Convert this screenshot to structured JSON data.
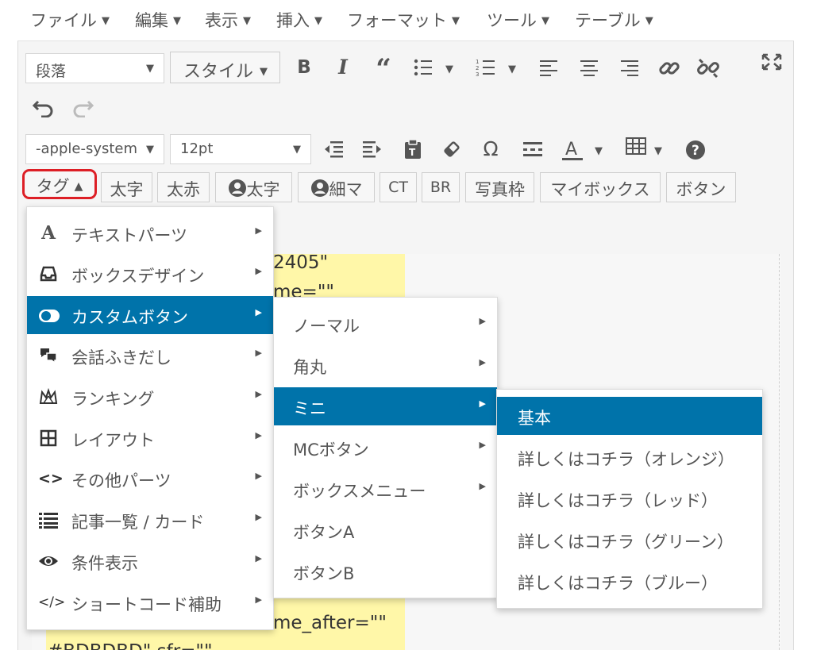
{
  "menubar": {
    "items": [
      "ファイル",
      "編集",
      "表示",
      "挿入",
      "フォーマット",
      "ツール",
      "テーブル"
    ]
  },
  "toolbar1": {
    "format_select": "段落",
    "style_button": "スタイル",
    "icons": [
      "bold-icon",
      "italic-icon",
      "blockquote-icon",
      "bullet-list-icon",
      "numbered-list-icon",
      "align-left-icon",
      "align-center-icon",
      "align-right-icon",
      "link-icon",
      "unlink-icon",
      "fullscreen-icon"
    ]
  },
  "toolbar2": {
    "icons": [
      "undo-icon",
      "redo-icon"
    ]
  },
  "toolbar3": {
    "font_family": "-apple-system",
    "font_size": "12pt",
    "icons": [
      "outdent-icon",
      "indent-icon",
      "paste-text-icon",
      "clear-format-icon",
      "special-char-icon",
      "horizontal-line-icon",
      "text-color-icon",
      "table-icon",
      "help-icon"
    ]
  },
  "tagbar": {
    "tag_button": "タグ",
    "buttons": [
      "太字",
      "太赤",
      "太字",
      "細マ",
      "CT",
      "BR",
      "写真枠",
      "マイボックス",
      "ボタン"
    ],
    "highlight_color": "#dd1f26"
  },
  "content": {
    "lines": [
      "2405\"",
      "me=\"\"",
      "me_after=\"\"",
      "#BDBDBD\"  sfr=\"\""
    ],
    "highlight_color": "#fff7a8"
  },
  "menu1": {
    "items": [
      {
        "label": "テキストパーツ",
        "icon": "letter-a-icon",
        "submenu": true
      },
      {
        "label": "ボックスデザイン",
        "icon": "inbox-icon",
        "submenu": true
      },
      {
        "label": "カスタムボタン",
        "icon": "toggle-icon",
        "submenu": true,
        "active": true
      },
      {
        "label": "会話ふきだし",
        "icon": "speech-bubbles-icon",
        "submenu": true
      },
      {
        "label": "ランキング",
        "icon": "crown-icon",
        "submenu": true
      },
      {
        "label": "レイアウト",
        "icon": "grid-icon",
        "submenu": true
      },
      {
        "label": "その他パーツ",
        "icon": "code-icon",
        "submenu": true
      },
      {
        "label": "記事一覧 / カード",
        "icon": "list-icon",
        "submenu": true
      },
      {
        "label": "条件表示",
        "icon": "eye-icon",
        "submenu": true
      },
      {
        "label": "ショートコード補助",
        "icon": "code-slash-icon",
        "submenu": true
      }
    ]
  },
  "menu2": {
    "items": [
      {
        "label": "ノーマル",
        "submenu": true
      },
      {
        "label": "角丸",
        "submenu": true
      },
      {
        "label": "ミニ",
        "submenu": true,
        "active": true
      },
      {
        "label": "MCボタン",
        "submenu": true
      },
      {
        "label": "ボックスメニュー",
        "submenu": true
      },
      {
        "label": "ボタンA",
        "submenu": false
      },
      {
        "label": "ボタンB",
        "submenu": false
      }
    ]
  },
  "menu3": {
    "items": [
      {
        "label": "基本",
        "active": true
      },
      {
        "label": "詳しくはコチラ（オレンジ）"
      },
      {
        "label": "詳しくはコチラ（レッド）"
      },
      {
        "label": "詳しくはコチラ（グリーン）"
      },
      {
        "label": "詳しくはコチラ（ブルー）"
      }
    ]
  },
  "colors": {
    "accent": "#0073aa"
  }
}
